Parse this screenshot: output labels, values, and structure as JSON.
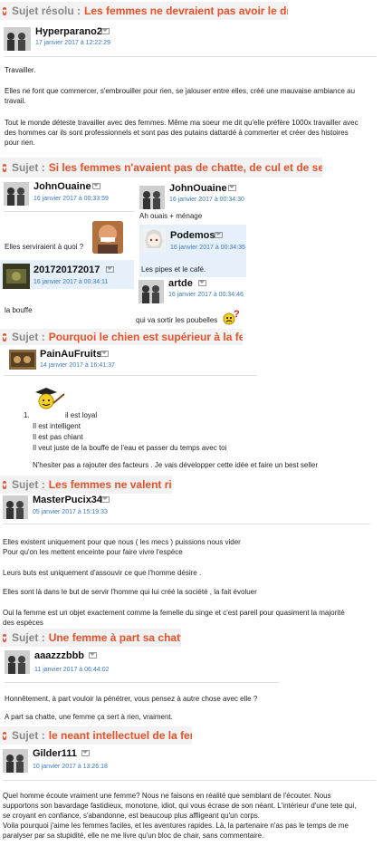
{
  "ui": {
    "sujet_label": "Sujet :",
    "accent": "#e8502a",
    "date_color": "#3a78c2",
    "mail_icon": "envelope-icon"
  },
  "thread1": {
    "sujet_label": "Sujet résolu :",
    "title": "Les femmes ne devraient pas avoir le droit de",
    "post": {
      "author": "Hyperparano2",
      "date": "17 janvier 2017 à 12:22:29"
    },
    "lines": [
      "Travailler.",
      "Elles ne font que commercer, s'embrouiller pour rien, se jalouser entre elles, créé une mauvaise ambiance au",
      "travail.",
      "Tout le monde déteste travailler avec des femmes. Même ma soeur me dit qu'elle préfère 1000x travailler avec",
      "des hommes car ils sont professionnels et sont pas des putains dattardé à commerter et créer des histoires",
      "pour rien."
    ]
  },
  "thread2": {
    "title": "Si les femmes n'avaient pas de chatte, de cul et de seins",
    "posts": [
      {
        "author": "JohnOuaine",
        "date": "16 janvier 2017 à 00:33:59",
        "text": "Elles serviraient à quoi ?"
      },
      {
        "author": "JohnOuaine",
        "date": "16 janvier 2017 à 00:34:30",
        "text": "Ah ouais + ménage"
      },
      {
        "author": "Podemos",
        "date": "16 janvier 2017 à 00:34:35",
        "text": "Les pipes et le café."
      },
      {
        "author": "201720172017",
        "date": "16 janvier 2017 à 00:34:11",
        "text": "la bouffe"
      },
      {
        "author": "artde",
        "date": "16 janvier 2017 à 00:34:46",
        "text": "qui va sortir les poubelles"
      }
    ]
  },
  "thread3": {
    "title": "Pourquoi le chien est supérieur à la femme",
    "post": {
      "author": "PainAuFruits",
      "date": "14 janvier 2017 à 16:41:37"
    },
    "list_num": "1.",
    "items": [
      "il est loyal",
      "Il est intelligent",
      "Il est pas chiant",
      "Il veut juste de la bouffe de l'eau et passer du temps avec toi"
    ],
    "footer": "N'hesiter pas a rajouter des facteurs . Je vais développer cette idée et faire un best seller"
  },
  "thread4": {
    "title": "Les femmes ne valent rien",
    "post": {
      "author": "MasterPucix34",
      "date": "05 janvier 2017 à 15:19:33"
    },
    "lines": [
      "Elles existent uniquement pour que nous ( les mecs ) puissions nous vider",
      "Pour qu'on les mettent enceinte pour faire vivre l'espèce",
      "Leurs buts est uniquement d'assouvir ce que l'homme désire .",
      "Elles sont là dans le but de servir l'homme qui lui créé la société , la fait évoluer",
      "Oui la femme est un objet exactement comme la femelle du singe et c'est pareil pour quasiment la majorité",
      "des espèces"
    ]
  },
  "thread5": {
    "title": "Une femme à part sa chatte ?",
    "post": {
      "author": "aaazzzbbb",
      "date": "11 janvier 2017 à 06:44:02"
    },
    "lines": [
      "Honnêtement, à part vouloir la pénétrer, vous pensez à autre chose avec elle ?",
      "A part sa chatte, une femme ça sert à rien, vraiment."
    ]
  },
  "thread6": {
    "title": "le neant intellectuel de la femme",
    "post": {
      "author": "Gilder111",
      "date": "10 janvier 2017 à 13:26:18"
    },
    "lines": [
      "Quel homme écoute vraiment une femme? Nous ne faisons en réalité que semblant de l'écouter. Nous",
      "supportons son bavardage fastidieux, monotone, idiot, qui vous écrase de son néant. L'intérieur d'une tete qui,",
      "se croyant en confiance, s'abandonne, est beaucoup plus affligeant qu'un corps.",
      "Voila pourquoi j'aime les femmes faciles, et les aventures rapides. Là, la partenaire n'as pas le temps de me",
      "paralyser par sa stupidité, elle ne me livre qu'un bloc de chair, sans commentaire."
    ]
  }
}
